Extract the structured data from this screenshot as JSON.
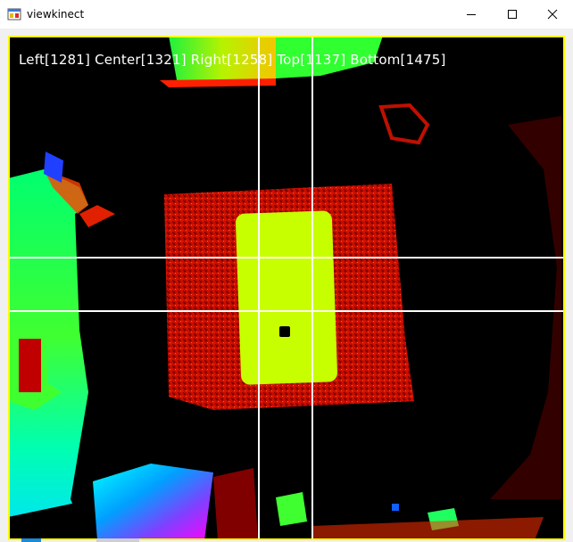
{
  "window": {
    "title": "viewkinect",
    "controls": {
      "minimize_icon": "minimize-icon",
      "maximize_icon": "maximize-icon",
      "close_icon": "close-icon"
    }
  },
  "depth_view": {
    "readout": "Left[1281] Center[1321] Right[1258] Top[1137] Bottom[1475]",
    "colors": {
      "frame": "#ffff00",
      "crosshair": "#ffffff",
      "readout_text": "#ffffff",
      "far": "#000000",
      "near_red": "#d01000",
      "mid_yellow": "#c8ff00",
      "green": "#30ff40",
      "cyan": "#00e0ff"
    }
  }
}
